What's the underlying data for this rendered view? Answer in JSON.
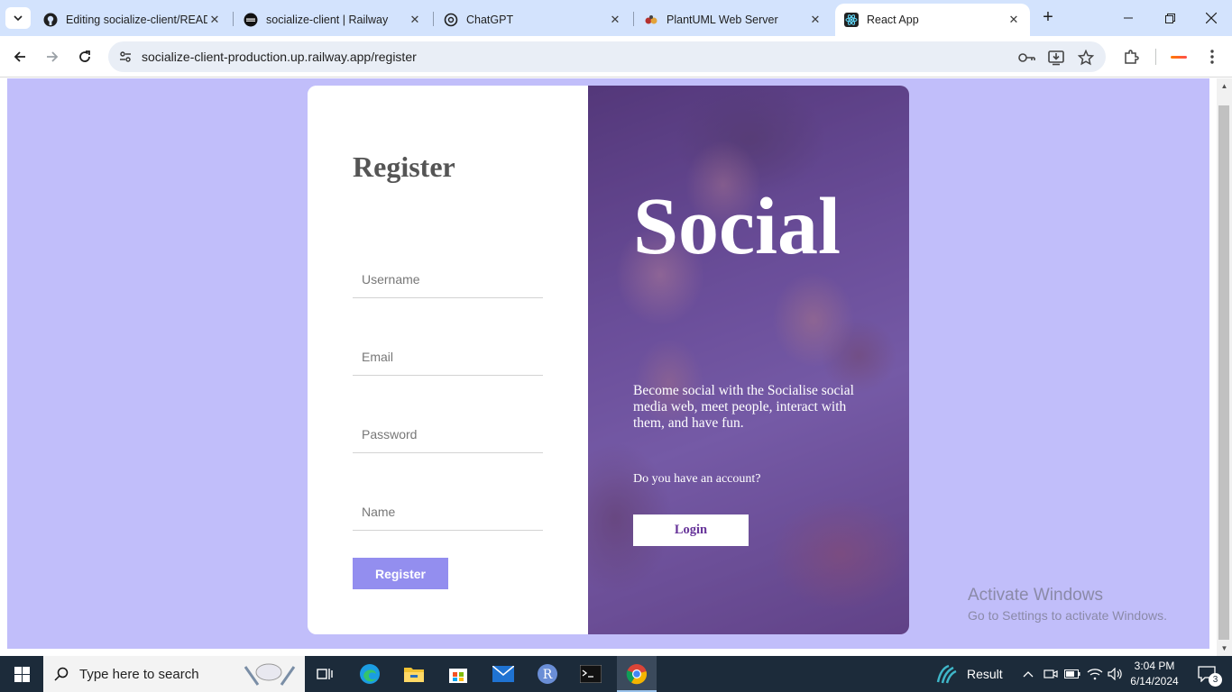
{
  "browser": {
    "tabs": [
      {
        "title": "Editing socialize-client/README",
        "icon": "github-icon"
      },
      {
        "title": "socialize-client | Railway",
        "icon": "railway-icon"
      },
      {
        "title": "ChatGPT",
        "icon": "chatgpt-icon"
      },
      {
        "title": "PlantUML Web Server",
        "icon": "plantuml-icon"
      },
      {
        "title": "React App",
        "icon": "react-icon",
        "active": true
      }
    ],
    "new_tab": "+",
    "url": "socialize-client-production.up.railway.app/register"
  },
  "register": {
    "title": "Register",
    "fields": {
      "username": "Username",
      "email": "Email",
      "password": "Password",
      "name": "Name"
    },
    "submit": "Register"
  },
  "promo": {
    "brand": "Social",
    "description": "Become social with the Socialise social media web, meet people, interact with them, and have fun.",
    "question": "Do you have an account?",
    "login": "Login"
  },
  "watermark": {
    "line1": "Activate Windows",
    "line2": "Go to Settings to activate Windows."
  },
  "taskbar": {
    "search_placeholder": "Type here to search",
    "weather": "Result",
    "time": "3:04 PM",
    "date": "6/14/2024",
    "notifications": "3"
  },
  "colors": {
    "page_bg": "#c1befa",
    "accent": "#938eef",
    "brand_purple": "#663399"
  }
}
